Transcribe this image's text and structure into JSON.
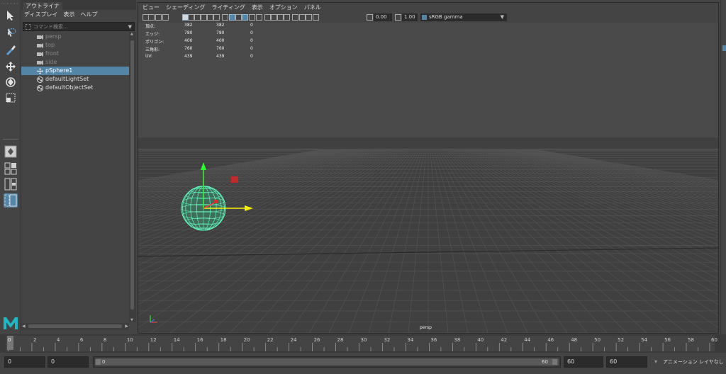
{
  "colors": {
    "accent": "#5285a6",
    "background": "#444444",
    "viewport_sky": "#4a4a4a",
    "viewport_ground": "#3f3f3f",
    "grid_line": "#555555",
    "sphere_wire": "#61f0b7",
    "axis_x": "#f7ef00",
    "axis_y": "#2bff2b",
    "maya_logo": "#1fb8c4"
  },
  "outliner": {
    "tab_title": "アウトライナ",
    "menu": [
      "ディスプレイ",
      "表示",
      "ヘルプ"
    ],
    "search_placeholder": "コマンド検索...",
    "items": [
      {
        "label": "persp",
        "icon": "camera-icon",
        "state": "dim"
      },
      {
        "label": "top",
        "icon": "camera-icon",
        "state": "dim"
      },
      {
        "label": "front",
        "icon": "camera-icon",
        "state": "dim"
      },
      {
        "label": "side",
        "icon": "camera-icon",
        "state": "dim"
      },
      {
        "label": "pSphere1",
        "icon": "transform-icon",
        "state": "selected"
      },
      {
        "label": "defaultLightSet",
        "icon": "set-icon",
        "state": "normal"
      },
      {
        "label": "defaultObjectSet",
        "icon": "set-icon",
        "state": "normal"
      }
    ]
  },
  "viewport": {
    "menu": [
      "ビュー",
      "シェーディング",
      "ライティング",
      "表示",
      "オプション",
      "パネル"
    ],
    "exposure": "0.00",
    "gamma": "1.00",
    "color_space": "sRGB gamma",
    "camera": "persp",
    "hud": [
      {
        "label": "頂点:",
        "a": "382",
        "b": "382",
        "c": "0"
      },
      {
        "label": "エッジ:",
        "a": "780",
        "b": "780",
        "c": "0"
      },
      {
        "label": "ポリゴン:",
        "a": "400",
        "b": "400",
        "c": "0"
      },
      {
        "label": "三角形:",
        "a": "760",
        "b": "760",
        "c": "0"
      },
      {
        "label": "UV:",
        "a": "439",
        "b": "439",
        "c": "0"
      }
    ]
  },
  "timeslider": {
    "current_frame": "0",
    "labels": [
      "0",
      "2",
      "4",
      "6",
      "8",
      "10",
      "12",
      "14",
      "16",
      "18",
      "20",
      "22",
      "24",
      "26",
      "28",
      "30",
      "32",
      "34",
      "36",
      "38",
      "40",
      "42",
      "44",
      "46",
      "48",
      "50",
      "52",
      "54",
      "56",
      "58",
      "60"
    ]
  },
  "rangebar": {
    "start": "0",
    "playback_start": "0",
    "range_low": "0",
    "range_high": "60",
    "playback_end": "60",
    "end": "60",
    "anim_layer": "アニメーション レイヤなし"
  },
  "toolbox": {
    "tools": [
      "select-tool-icon",
      "lasso-tool-icon",
      "paint-select-icon",
      "move-tool-icon",
      "rotate-tool-icon",
      "scale-tool-icon"
    ],
    "logo": "maya-logo"
  }
}
